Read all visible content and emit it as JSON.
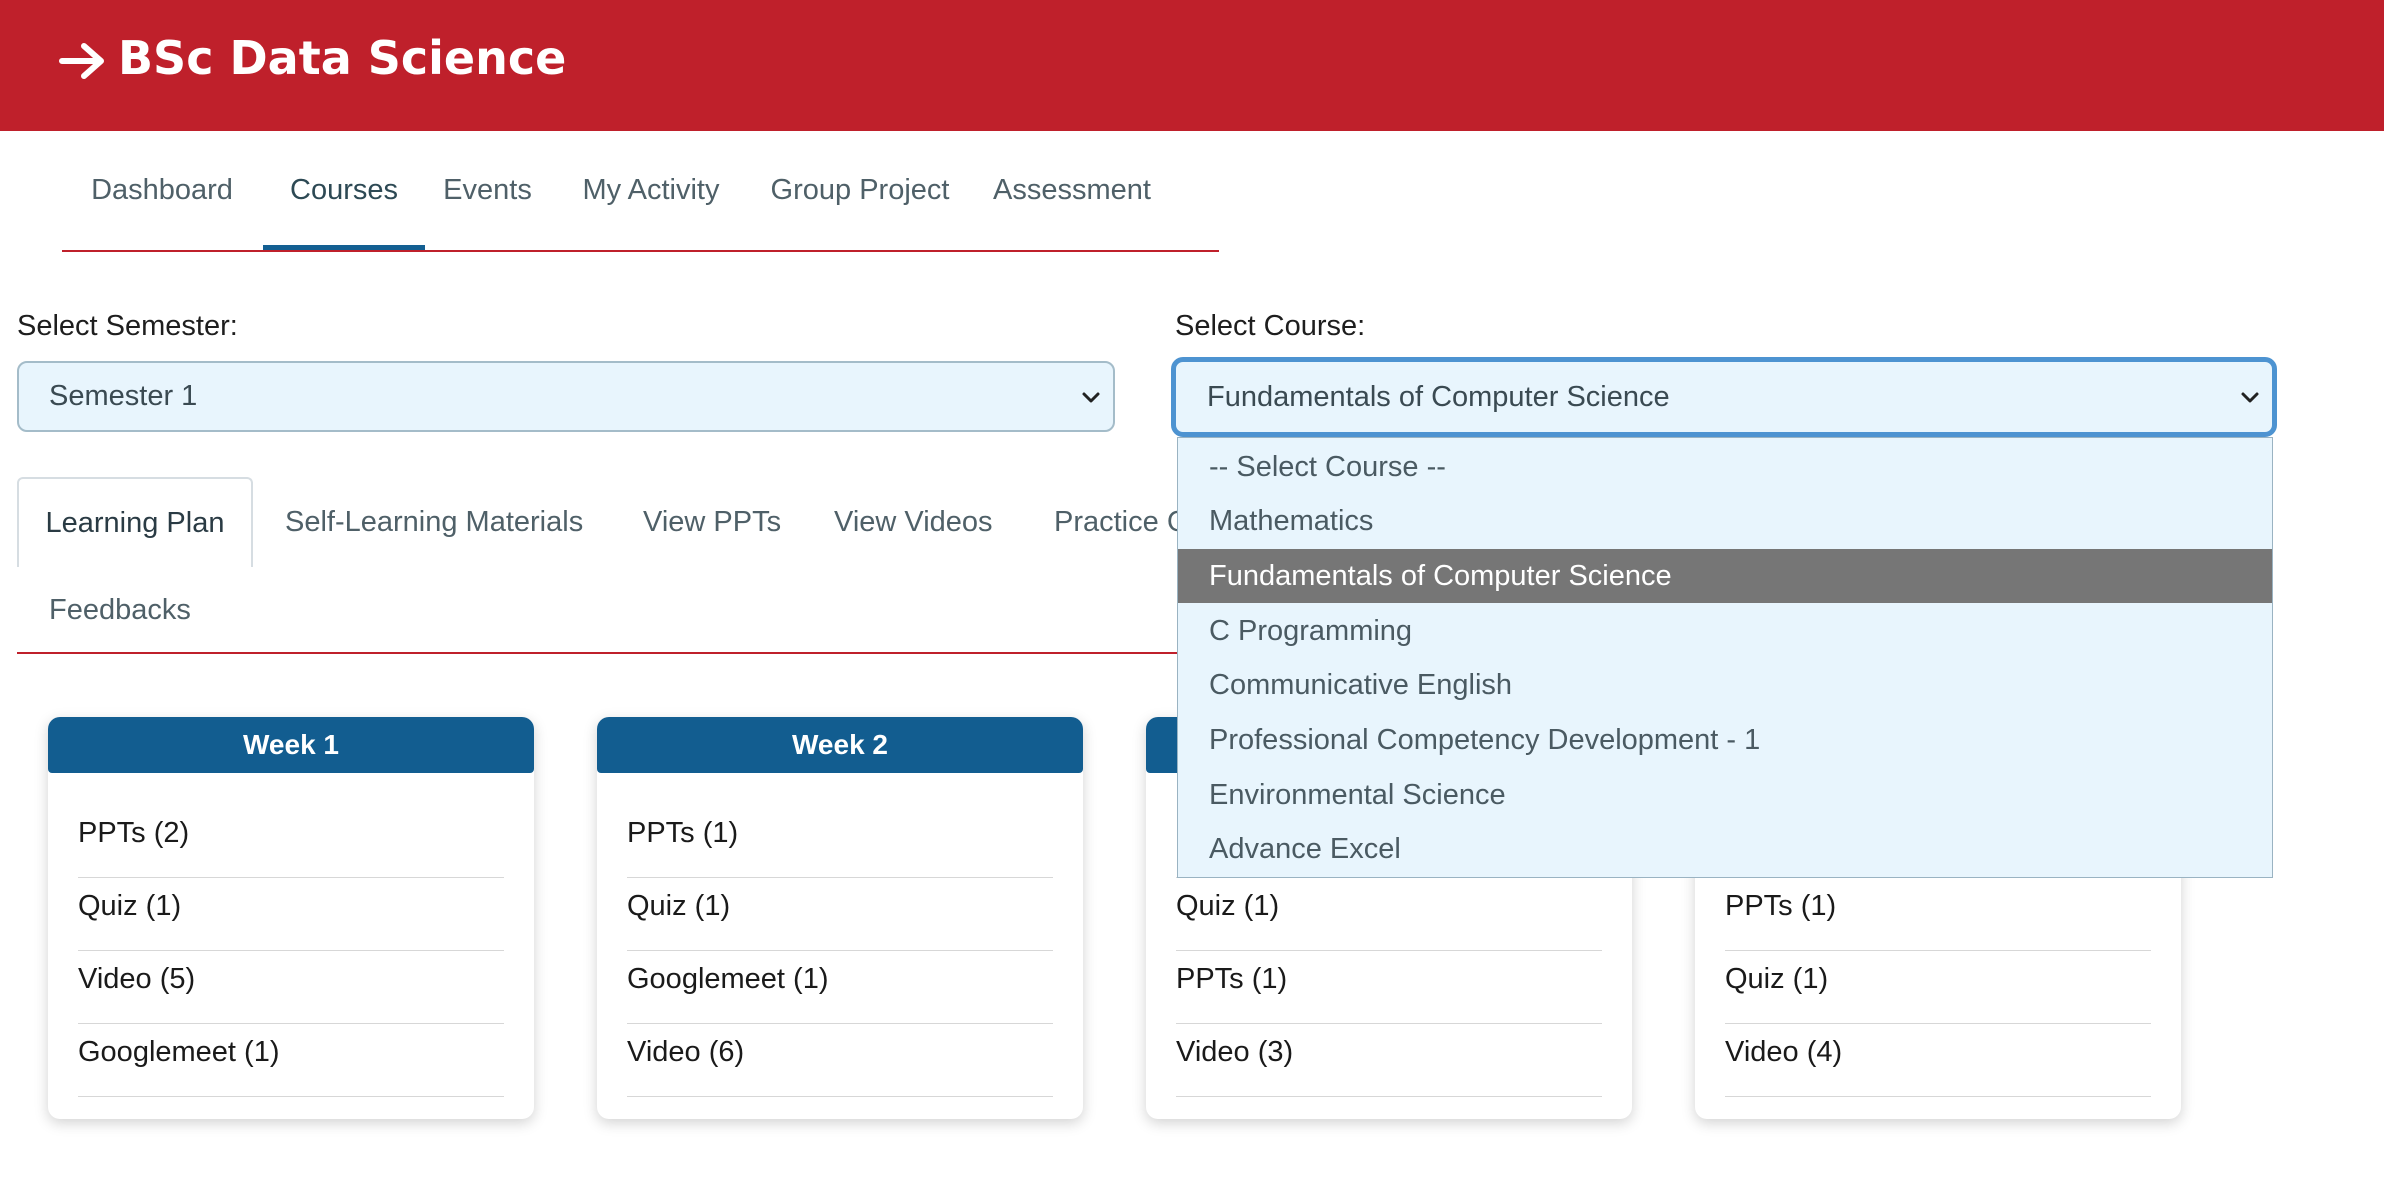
{
  "header": {
    "title": "BSc Data Science"
  },
  "nav": {
    "items": [
      {
        "label": "Dashboard"
      },
      {
        "label": "Courses"
      },
      {
        "label": "Events"
      },
      {
        "label": "My Activity"
      },
      {
        "label": "Group Project"
      },
      {
        "label": "Assessment"
      }
    ],
    "active": "Courses"
  },
  "semester": {
    "label": "Select Semester:",
    "value": "Semester 1"
  },
  "course": {
    "label": "Select Course:",
    "value": "Fundamentals of Computer Science",
    "options": [
      "-- Select Course --",
      "Mathematics",
      "Fundamentals of Computer Science",
      "C Programming",
      "Communicative English",
      "Professional Competency Development - 1",
      "Environmental Science",
      "Advance Excel"
    ],
    "selected_index": 2
  },
  "tabs": {
    "items": [
      "Learning Plan",
      "Self-Learning Materials",
      "View PPTs",
      "View Videos",
      "Practice C",
      "Feedbacks"
    ],
    "active": "Learning Plan"
  },
  "weeks": [
    {
      "title": "Week 1",
      "items": [
        "PPTs (2)",
        "Quiz (1)",
        "Video (5)",
        "Googlemeet (1)"
      ]
    },
    {
      "title": "Week 2",
      "items": [
        "PPTs (1)",
        "Quiz (1)",
        "Googlemeet (1)",
        "Video (6)"
      ]
    },
    {
      "title": "",
      "items": [
        "",
        "Quiz (1)",
        "PPTs (1)",
        "Video (3)"
      ]
    },
    {
      "title": "",
      "items": [
        "",
        "PPTs (1)",
        "Quiz (1)",
        "Video (4)"
      ]
    }
  ],
  "colors": {
    "brand_red": "#bf202b",
    "week_header_blue": "#125d90",
    "select_bg": "#e8f5fd",
    "focus_ring": "#4d93d1"
  }
}
